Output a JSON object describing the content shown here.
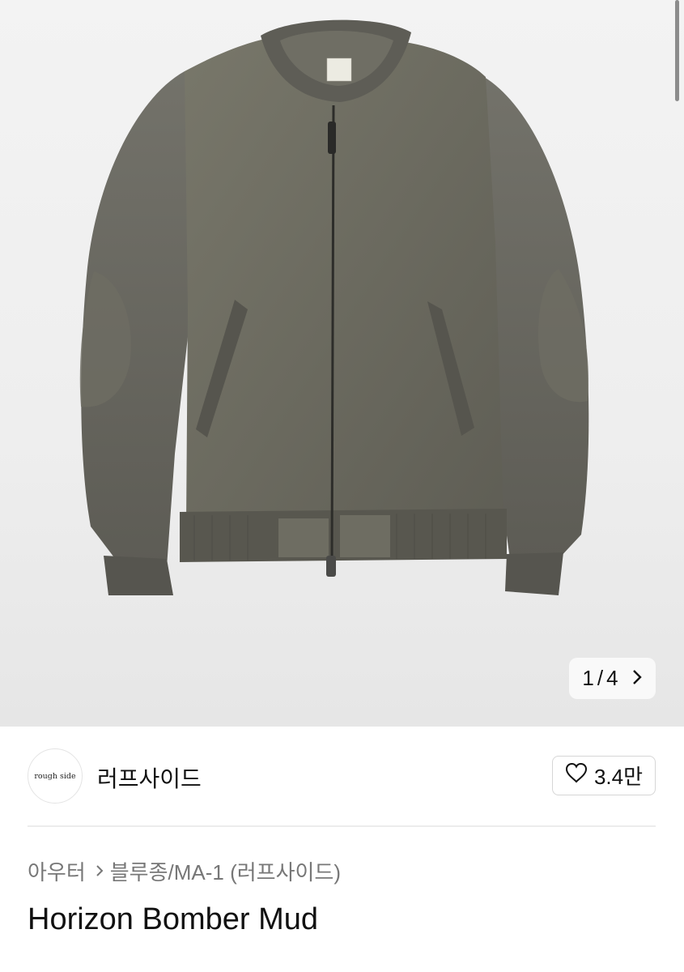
{
  "gallery": {
    "current": "1",
    "total": "4",
    "pager_separator": "/"
  },
  "brand": {
    "logo_text": "rough side",
    "name": "러프사이드",
    "like_count": "3.4만"
  },
  "breadcrumb": {
    "category": "아우터",
    "subcategory": "블루종/MA-1 (러프사이드)"
  },
  "product": {
    "title": "Horizon Bomber Mud",
    "label_text": "rough side"
  },
  "icons": {
    "pager_next": "chevron-right-icon",
    "like": "heart-icon",
    "breadcrumb_sep": "chevron-right-icon"
  },
  "colors": {
    "jacket": "#6b6a5e",
    "rib": "#575750",
    "accent": "#111111"
  }
}
